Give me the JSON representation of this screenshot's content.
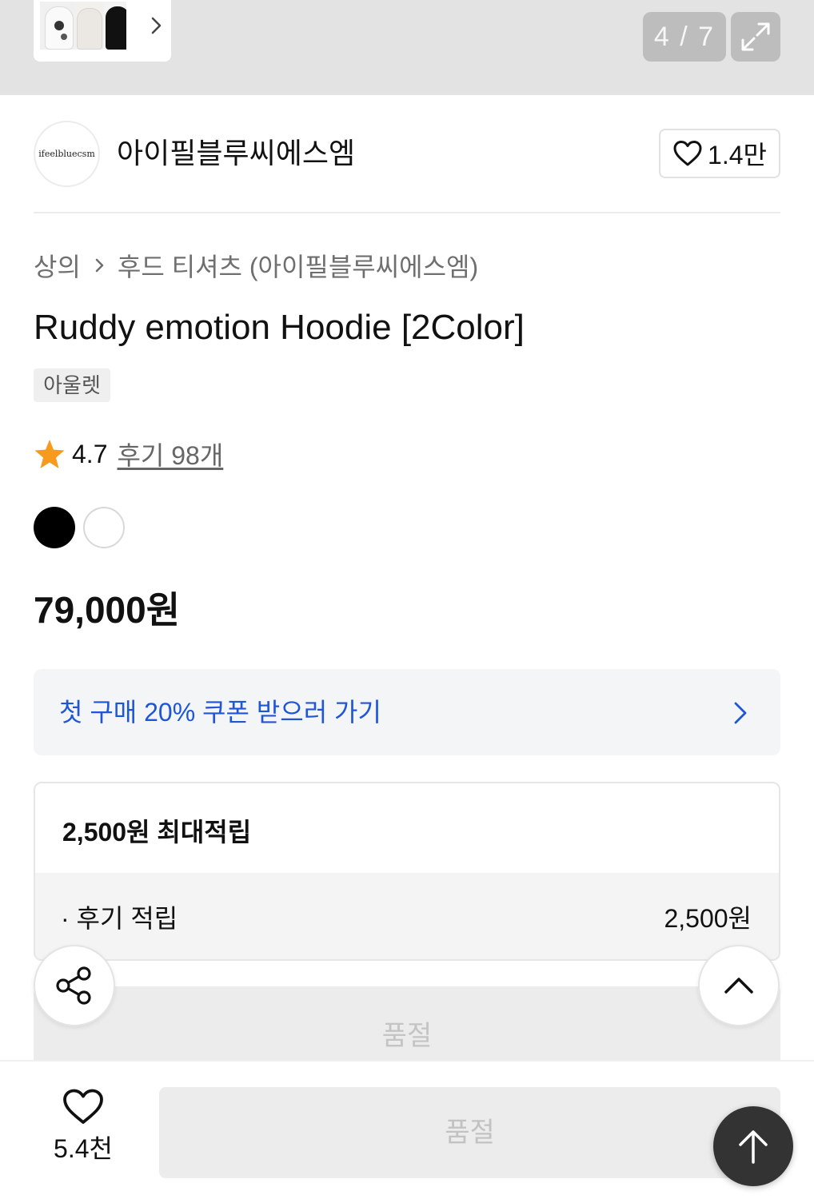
{
  "gallery": {
    "counter": "4 / 7",
    "thumbnails": [
      "hoodie-white-front",
      "hoodie-beige",
      "hoodie-black"
    ]
  },
  "brand": {
    "logo_text": "ifeelbluecsm",
    "name": "아이필블루씨에스엠",
    "like_count": "1.4만"
  },
  "breadcrumb": {
    "category": "상의",
    "subcategory": "후드 티셔츠 (아이필블루씨에스엠)"
  },
  "product": {
    "title": "Ruddy emotion Hoodie [2Color]",
    "tag": "아울렛",
    "rating": "4.7",
    "review_link": "후기 98개",
    "colors": [
      "#000000",
      "#ffffff"
    ],
    "price": "79,000원"
  },
  "coupon": {
    "text": "첫 구매 20% 쿠폰 받으러 가기"
  },
  "points": {
    "title": "2,500원 최대적립",
    "rows": [
      {
        "label": "· 후기 적립",
        "value": "2,500원"
      }
    ]
  },
  "soldout_strip": {
    "label": "품절"
  },
  "bottom_bar": {
    "wish_count": "5.4천",
    "action_label": "품절"
  },
  "icons": {
    "thumb_next": "chevron-right-icon",
    "expand": "expand-icon",
    "brand_like": "heart-icon",
    "rating": "star-icon",
    "share": "share-icon",
    "collapse": "chevron-up-icon",
    "scroll_top": "arrow-up-icon"
  },
  "colors": {
    "accent_blue": "#1f56d6",
    "star": "#f79a1e",
    "disabled_bg": "#ececec",
    "disabled_text": "#c2c2c2"
  }
}
